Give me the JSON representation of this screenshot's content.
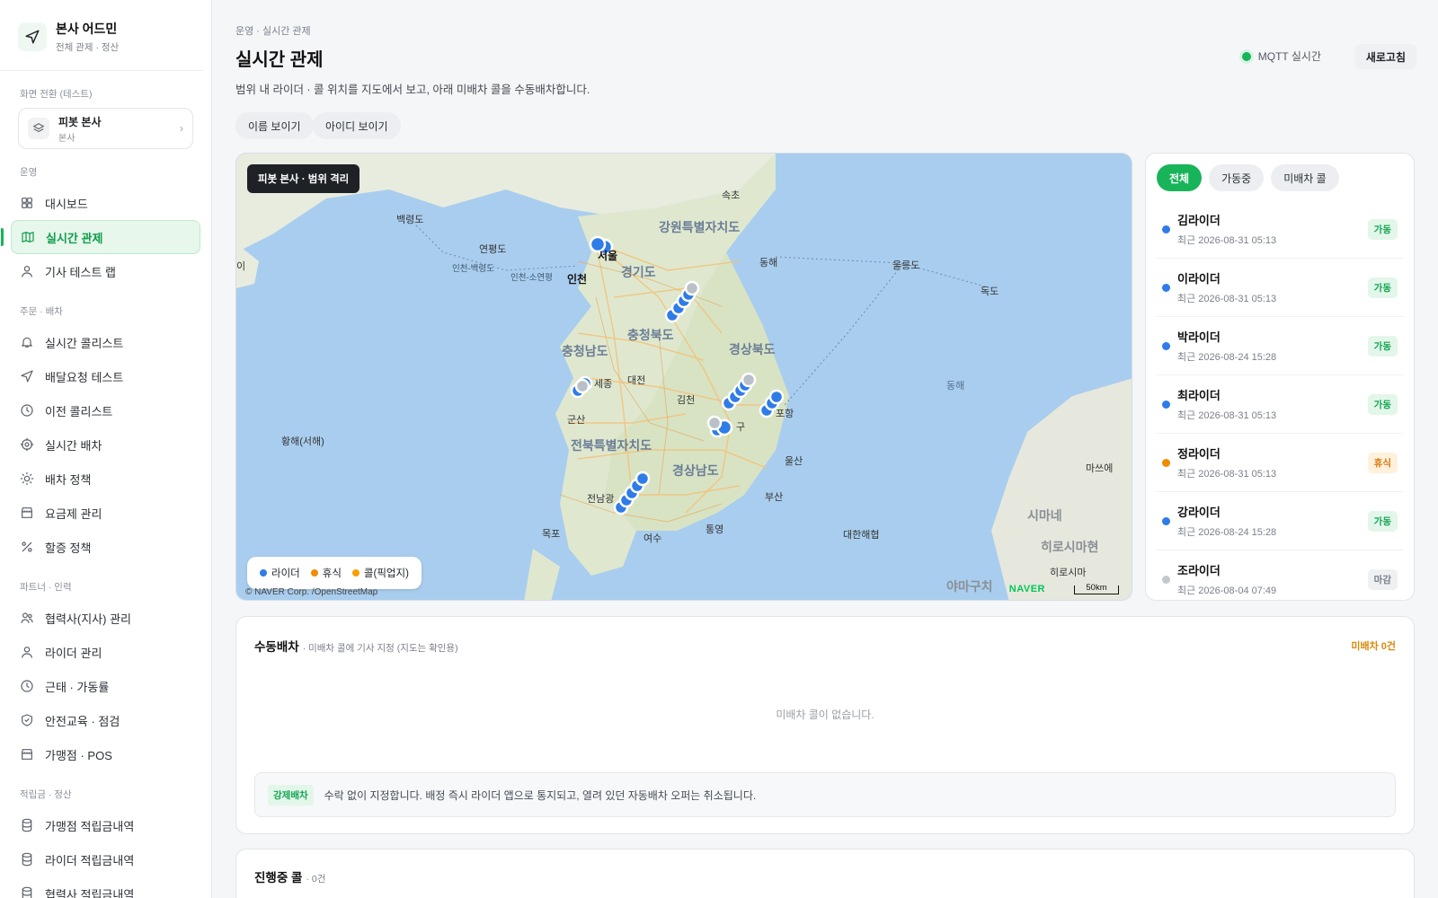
{
  "brand": {
    "title": "본사 어드민",
    "subtitle": "전체 관제 · 정산"
  },
  "switcher": {
    "label": "화면 전환 (테스트)",
    "title": "피봇 본사",
    "subtitle": "본사"
  },
  "nav": {
    "sections": [
      {
        "label": "운영",
        "items": [
          {
            "label": "대시보드",
            "icon": "grid-icon"
          },
          {
            "label": "실시간 관제",
            "icon": "map-icon",
            "active": true
          },
          {
            "label": "기사 테스트 랩",
            "icon": "user-icon"
          }
        ]
      },
      {
        "label": "주문 · 배차",
        "items": [
          {
            "label": "실시간 콜리스트",
            "icon": "bell-icon"
          },
          {
            "label": "배달요청 테스트",
            "icon": "send-icon"
          },
          {
            "label": "이전 콜리스트",
            "icon": "clock-icon"
          },
          {
            "label": "실시간 배차",
            "icon": "target-icon"
          },
          {
            "label": "배차 정책",
            "icon": "sun-icon"
          },
          {
            "label": "요금제 관리",
            "icon": "store-icon"
          },
          {
            "label": "할증 정책",
            "icon": "percent-icon"
          }
        ]
      },
      {
        "label": "파트너 · 인력",
        "items": [
          {
            "label": "협력사(지사) 관리",
            "icon": "users-icon"
          },
          {
            "label": "라이더 관리",
            "icon": "user-icon"
          },
          {
            "label": "근태 · 가동률",
            "icon": "clock-icon"
          },
          {
            "label": "안전교육 · 점검",
            "icon": "shield-icon"
          },
          {
            "label": "가맹점 · POS",
            "icon": "store-icon"
          }
        ]
      },
      {
        "label": "적립금 · 정산",
        "items": [
          {
            "label": "가맹점 적립금내역",
            "icon": "database-icon"
          },
          {
            "label": "라이더 적립금내역",
            "icon": "database-icon"
          },
          {
            "label": "협력사 적립금내역",
            "icon": "database-icon"
          }
        ]
      }
    ]
  },
  "header": {
    "breadcrumb": "운영 · 실시간 관제",
    "title": "실시간 관제",
    "description": "범위 내 라이더 · 콜 위치를 지도에서 보고, 아래 미배차 콜을 수동배차합니다.",
    "mqtt_label": "MQTT 실시간",
    "refresh_label": "새로고침",
    "show_name_label": "이름 보이기",
    "show_id_label": "아이디 보이기"
  },
  "map": {
    "badge": "피봇 본사 · 범위 격리",
    "legend": [
      {
        "label": "라이더",
        "color": "#2f7be8"
      },
      {
        "label": "휴식",
        "color": "#f08c00"
      },
      {
        "label": "콜(픽업지)",
        "color": "#f59f00"
      }
    ],
    "copyright": "© NAVER Corp. /OpenStreetMap",
    "naver": "NAVER",
    "scale": "50km",
    "places": {
      "p1": "속초",
      "p2": "강원특별자치도",
      "p3": "백령도",
      "p4": "연평도",
      "p5": "서울",
      "p6": "경기도",
      "p7": "인천",
      "p8": "동해",
      "p9": "울릉도",
      "p10": "독도",
      "p11": "충청남도",
      "p12": "충청북도",
      "p13": "경상북도",
      "p14": "세종",
      "p15": "대전",
      "p16": "김천",
      "p17": "포항",
      "p18": "군산",
      "p19": "황해(서해)",
      "p20": "전북특별자치도",
      "p21": "경상남도",
      "p22": "울산",
      "p23": "전남광",
      "p24": "부산",
      "p25": "목포",
      "p26": "통영",
      "p27": "여수",
      "p28": "대한해협",
      "p29": "마쓰에",
      "p30": "시마네",
      "p31": "히로시마현",
      "p32": "히로시마",
      "p33": "야마구치",
      "p34": "동해",
      "p35": "인천-백령도",
      "p36": "인천-소연평",
      "p37": "이",
      "p38": "구"
    }
  },
  "rider_panel": {
    "tabs": [
      "전체",
      "가동중",
      "미배차 콜"
    ],
    "riders": [
      {
        "name": "김라이더",
        "time": "최근 2026-08-31 05:13",
        "status": "가동",
        "dot": "#2f7be8",
        "badge_bg": "#e3f6ea",
        "badge_fg": "#13a552"
      },
      {
        "name": "이라이더",
        "time": "최근 2026-08-31 05:13",
        "status": "가동",
        "dot": "#2f7be8",
        "badge_bg": "#e3f6ea",
        "badge_fg": "#13a552"
      },
      {
        "name": "박라이더",
        "time": "최근 2026-08-24 15:28",
        "status": "가동",
        "dot": "#2f7be8",
        "badge_bg": "#e3f6ea",
        "badge_fg": "#13a552"
      },
      {
        "name": "최라이더",
        "time": "최근 2026-08-31 05:13",
        "status": "가동",
        "dot": "#2f7be8",
        "badge_bg": "#e3f6ea",
        "badge_fg": "#13a552"
      },
      {
        "name": "정라이더",
        "time": "최근 2026-08-31 05:13",
        "status": "휴식",
        "dot": "#f08c00",
        "badge_bg": "#fff1dc",
        "badge_fg": "#d9780b"
      },
      {
        "name": "강라이더",
        "time": "최근 2026-08-24 15:28",
        "status": "가동",
        "dot": "#2f7be8",
        "badge_bg": "#e3f6ea",
        "badge_fg": "#13a552"
      },
      {
        "name": "조라이더",
        "time": "최근 2026-08-04 07:49",
        "status": "마감",
        "dot": "#c4c8cd",
        "badge_bg": "#eef0f2",
        "badge_fg": "#7a808a"
      }
    ]
  },
  "dispatch": {
    "title": "수동배차",
    "subtitle": "· 미배차 콜에 기사 지정 (지도는 확인용)",
    "unassigned": "미배차 0건",
    "empty": "미배차 콜이 없습니다.",
    "force_tag": "강제배차",
    "force_text": "수락 없이 지정합니다. 배정 즉시 라이더 앱으로 통지되고, 열려 있던 자동배차 오퍼는 취소됩니다."
  },
  "progress": {
    "title": "진행중 콜",
    "count": "· 0건"
  }
}
